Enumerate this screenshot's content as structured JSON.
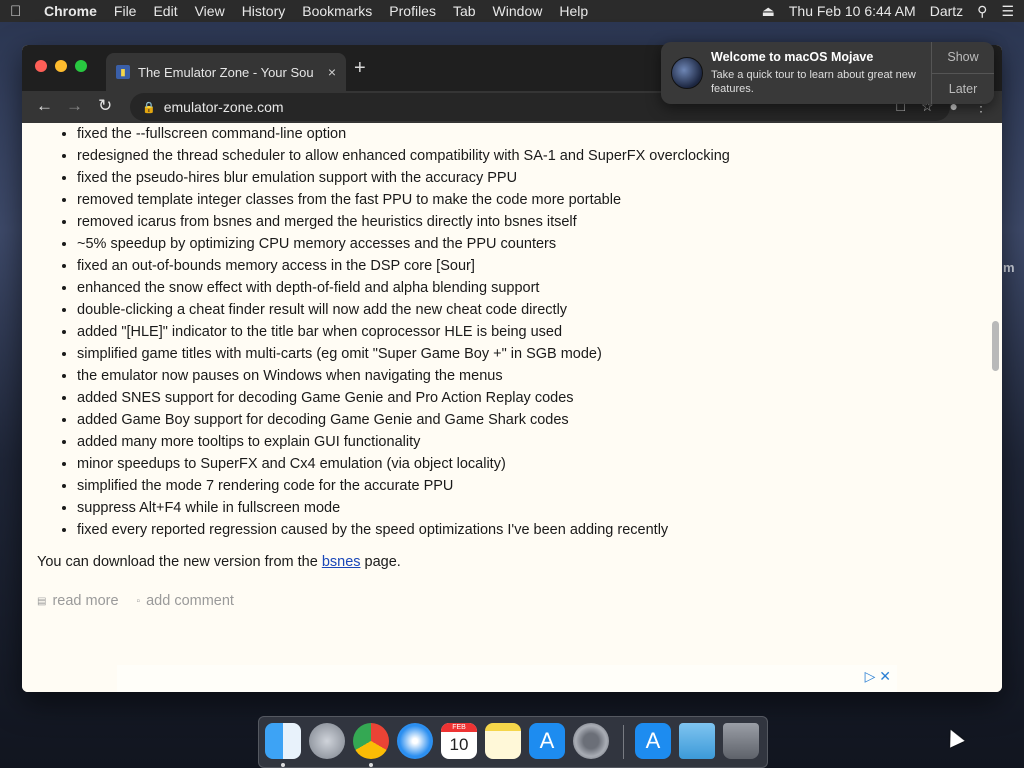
{
  "menubar": {
    "app": "Chrome",
    "items": [
      "File",
      "Edit",
      "View",
      "History",
      "Bookmarks",
      "Profiles",
      "Tab",
      "Window",
      "Help"
    ],
    "datetime": "Thu Feb 10  6:44 AM",
    "user": "Dartz"
  },
  "browser": {
    "tab_title": "The Emulator Zone - Your Sour",
    "url": "emulator-zone.com"
  },
  "page": {
    "changes": [
      "fixed the --fullscreen command-line option",
      "redesigned the thread scheduler to allow enhanced compatibility with SA-1 and SuperFX overclocking",
      "fixed the pseudo-hires blur emulation support with the accuracy PPU",
      "removed template integer classes from the fast PPU to make the code more portable",
      "removed icarus from bsnes and merged the heuristics directly into bsnes itself",
      "~5% speedup by optimizing CPU memory accesses and the PPU counters",
      "fixed an out-of-bounds memory access in the DSP core [Sour]",
      "enhanced the snow effect with depth-of-field and alpha blending support",
      "double-clicking a cheat finder result will now add the new cheat code directly",
      "added \"[HLE]\" indicator to the title bar when coprocessor HLE is being used",
      "simplified game titles with multi-carts (eg omit \"Super Game Boy +\" in SGB mode)",
      "the emulator now pauses on Windows when navigating the menus",
      "added SNES support for decoding Game Genie and Pro Action Replay codes",
      "added Game Boy support for decoding Game Genie and Game Shark codes",
      "added many more tooltips to explain GUI functionality",
      "minor speedups to SuperFX and Cx4 emulation (via object locality)",
      "simplified the mode 7 rendering code for the accurate PPU",
      "suppress Alt+F4 while in fullscreen mode",
      "fixed every reported regression caused by the speed optimizations I've been adding recently"
    ],
    "download_prefix": "You can download the new version from the ",
    "download_link": "bsnes",
    "download_suffix": " page.",
    "read_more": "read more",
    "add_comment": "add comment"
  },
  "notification": {
    "title": "Welcome to macOS Mojave",
    "body": "Take a quick tour to learn about great new features.",
    "show": "Show",
    "later": "Later"
  },
  "calendar": {
    "month": "FEB",
    "day": "10"
  },
  "side_text": "m",
  "colors": {
    "page_bg": "#fffcf4",
    "link": "#1a47b8",
    "chrome_dark": "#1f1f1f",
    "menubar": "#2b2b2b"
  },
  "dock_icons": [
    "finder-icon",
    "launchpad-icon",
    "chrome-icon",
    "safari-icon",
    "calendar-icon",
    "notes-icon",
    "app-store-icon",
    "system-preferences-icon",
    "app-store-icon",
    "downloads-folder-icon",
    "trash-icon"
  ]
}
